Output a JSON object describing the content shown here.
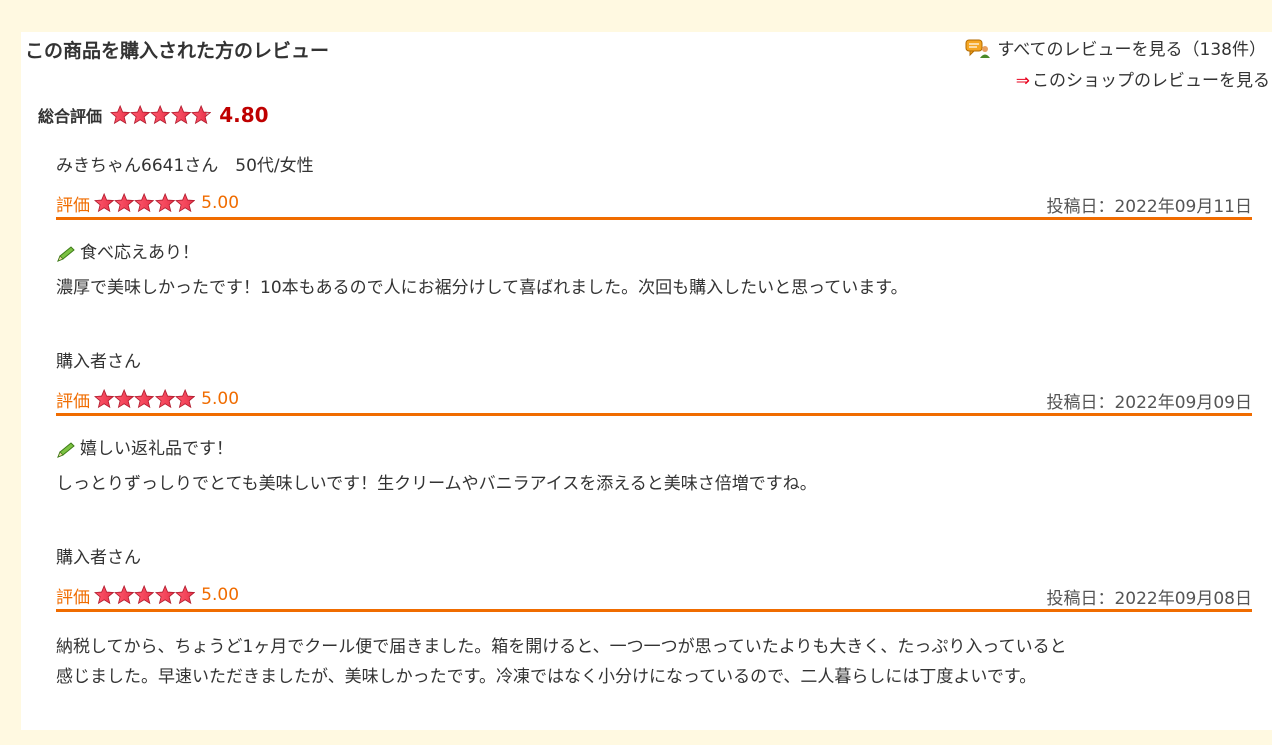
{
  "header": {
    "title": "この商品を購入された方のレビュー",
    "all_reviews_link": "すべてのレビューを見る（138件）",
    "shop_reviews_arrow": "⇒",
    "shop_reviews_link": "このショップのレビューを見る"
  },
  "overall": {
    "label": "総合評価",
    "score": "4.80",
    "stars": 4.8
  },
  "colors": {
    "accent": "#f06c00",
    "score_red": "#bf0000",
    "star_red": "#e8334a",
    "background": "#fff9e1"
  },
  "reviews": [
    {
      "reviewer": "みきちゃん6641さん　50代/女性",
      "rating_label": "評価",
      "rating_value": "5.00",
      "stars": 5,
      "date": "投稿日：2022年09月11日",
      "title": "食べ応えあり！",
      "body": "濃厚で美味しかったです！10本もあるので人にお裾分けして喜ばれました。次回も購入したいと思っています。"
    },
    {
      "reviewer": "購入者さん",
      "rating_label": "評価",
      "rating_value": "5.00",
      "stars": 5,
      "date": "投稿日：2022年09月09日",
      "title": "嬉しい返礼品です！",
      "body": "しっとりずっしりでとても美味しいです！生クリームやバニラアイスを添えると美味さ倍増ですね。"
    },
    {
      "reviewer": "購入者さん",
      "rating_label": "評価",
      "rating_value": "5.00",
      "stars": 5,
      "date": "投稿日：2022年09月08日",
      "title": "",
      "body_line1": "納税してから、ちょうど1ヶ月でクール便で届きました。箱を開けると、一つ一つが思っていたよりも大きく、たっぷり入っていると",
      "body_line2": "感じました。早速いただきましたが、美味しかったです。冷凍ではなく小分けになっているので、二人暮らしには丁度よいです。"
    }
  ]
}
